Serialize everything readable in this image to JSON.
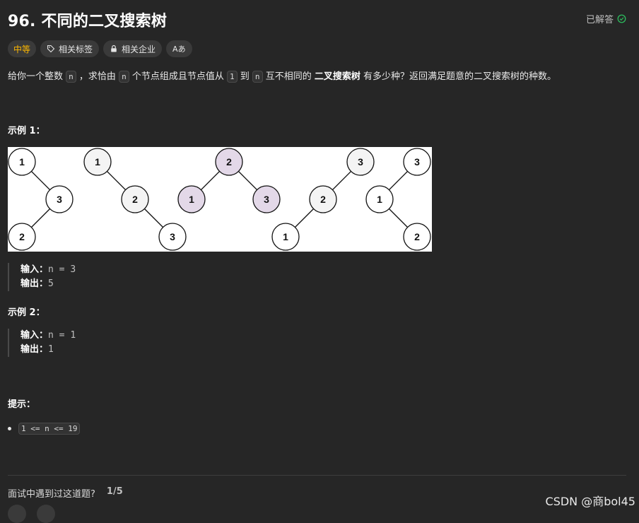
{
  "problem": {
    "title": "96. 不同的二叉搜索树",
    "solved_label": "已解答"
  },
  "tags": {
    "difficulty": "中等",
    "related_tags": "相关标签",
    "related_companies": "相关企业",
    "font_icon_text": "Aあ"
  },
  "description": {
    "p1": "给你一个整数",
    "n": "n",
    "p2": "，求恰由",
    "p3": "个节点组成且节点值从",
    "one": "1",
    "p4": "到",
    "p5": "互不相同的",
    "bst": "二叉搜索树",
    "p6": "有多少种？返回满足题意的二叉搜索树的种数。"
  },
  "example1": {
    "heading": "示例 1：",
    "input_label": "输入：",
    "input_value": "n = 3",
    "output_label": "输出：",
    "output_value": "5"
  },
  "example2": {
    "heading": "示例 2：",
    "input_label": "输入：",
    "input_value": "n = 1",
    "output_label": "输出：",
    "output_value": "1"
  },
  "hints": {
    "heading": "提示：",
    "constraint": "1 <= n <= 19"
  },
  "footer": {
    "question": "面试中遇到过这道题?",
    "count": "1/5"
  },
  "watermark": "CSDN @商bol45",
  "colors": {
    "accent_difficulty": "#ffb800",
    "solved_check": "#2cbb5d",
    "node_highlight": "#e3d8e8",
    "node_default": "#f4f4f4"
  },
  "trees": [
    {
      "nodes": [
        "1",
        "3",
        "2"
      ],
      "highlight": false
    },
    {
      "nodes": [
        "1",
        "2",
        "3"
      ],
      "highlight": false
    },
    {
      "nodes": [
        "2",
        "1",
        "3"
      ],
      "highlight": true
    },
    {
      "nodes": [
        "3",
        "2",
        "1"
      ],
      "highlight": false
    },
    {
      "nodes": [
        "3",
        "1",
        "2"
      ],
      "highlight": false
    }
  ]
}
